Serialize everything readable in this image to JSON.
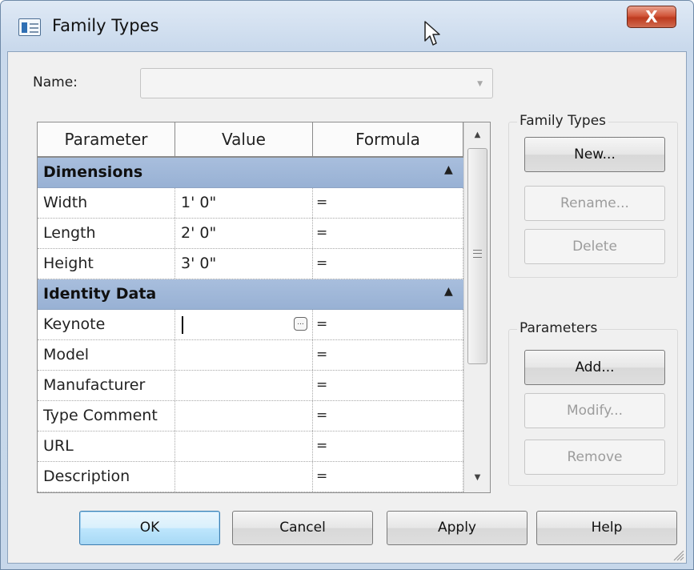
{
  "window": {
    "title": "Family Types",
    "close_glyph": "X"
  },
  "name_field": {
    "label": "Name:",
    "value": ""
  },
  "grid": {
    "columns": [
      "Parameter",
      "Value",
      "Formula"
    ],
    "sections": [
      {
        "label": "Dimensions",
        "rows": [
          {
            "parameter": "Width",
            "value": "1'  0\"",
            "formula": "="
          },
          {
            "parameter": "Length",
            "value": "2'  0\"",
            "formula": "="
          },
          {
            "parameter": "Height",
            "value": "3'  0\"",
            "formula": "="
          }
        ]
      },
      {
        "label": "Identity Data",
        "rows": [
          {
            "parameter": "Keynote",
            "value": "",
            "formula": "="
          },
          {
            "parameter": "Model",
            "value": "",
            "formula": "="
          },
          {
            "parameter": "Manufacturer",
            "value": "",
            "formula": "="
          },
          {
            "parameter": "Type Comment",
            "value": "",
            "formula": "="
          },
          {
            "parameter": "URL",
            "value": "",
            "formula": "="
          },
          {
            "parameter": "Description",
            "value": "",
            "formula": "="
          }
        ]
      }
    ],
    "section_chevron": "»",
    "browse_button_glyph": "..."
  },
  "family_types_group": {
    "label": "Family Types",
    "new_label": "New...",
    "rename_label": "Rename...",
    "delete_label": "Delete"
  },
  "parameters_group": {
    "label": "Parameters",
    "add_label": "Add...",
    "modify_label": "Modify...",
    "remove_label": "Remove"
  },
  "footer": {
    "ok_label": "OK",
    "cancel_label": "Cancel",
    "apply_label": "Apply",
    "help_label": "Help"
  },
  "colors": {
    "section_header": "#a8bedd",
    "close_button": "#c8472b",
    "default_button_border": "#3c7fb1"
  },
  "icons": {
    "title": "family-types-dialog-icon",
    "cursor": "mouse-pointer-icon",
    "close": "close-icon",
    "scroll_up": "triangle-up-icon",
    "scroll_down": "triangle-down-icon",
    "resize": "resize-grip-icon"
  }
}
